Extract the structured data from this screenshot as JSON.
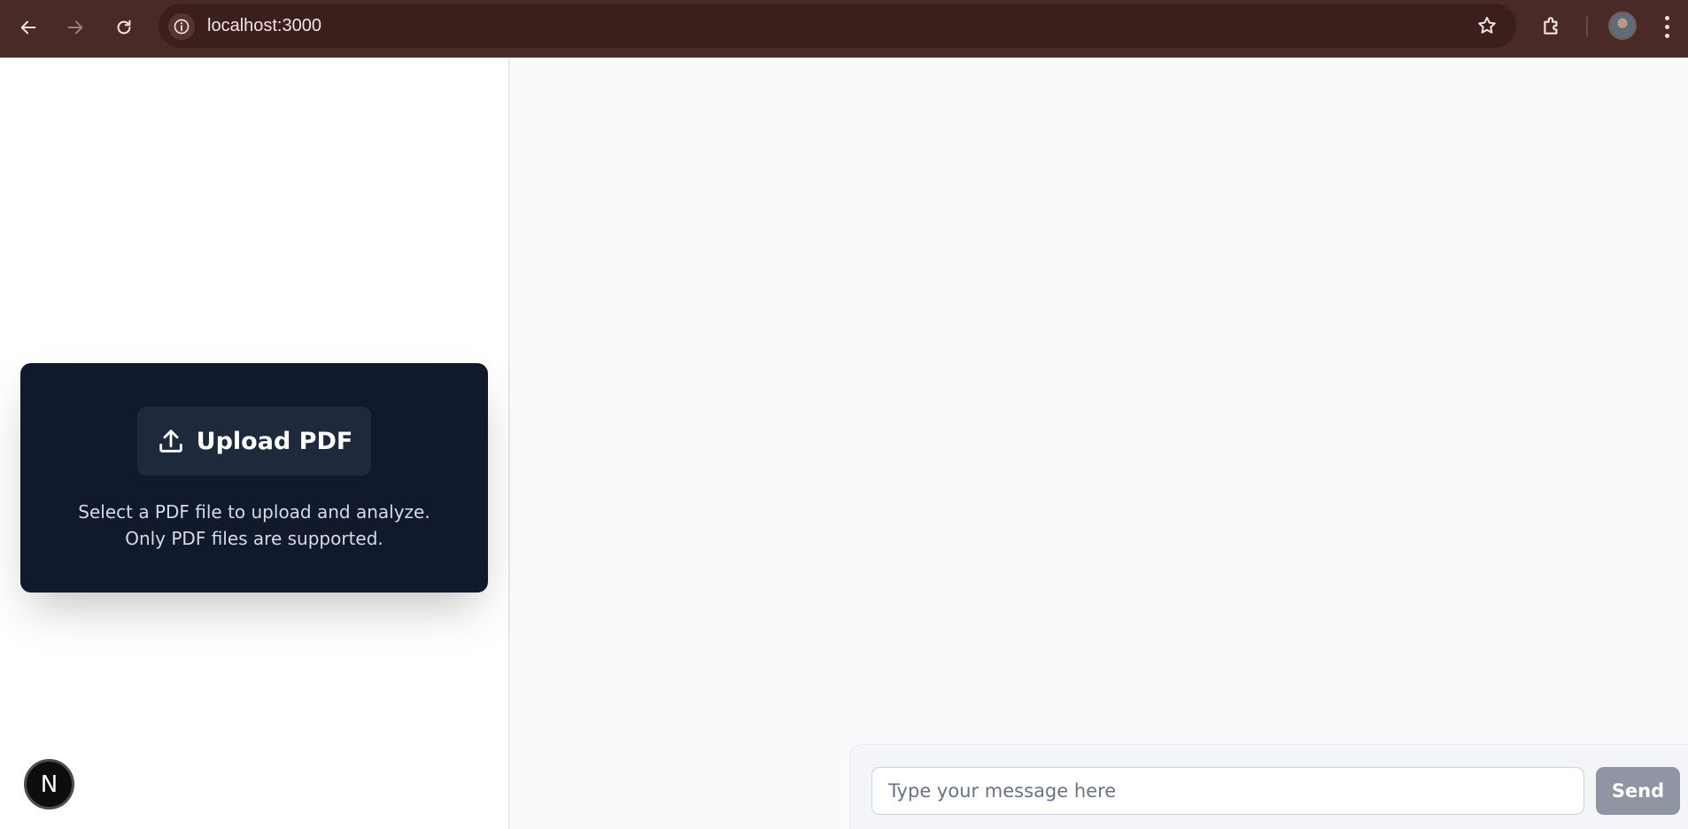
{
  "browser": {
    "url": "localhost:3000",
    "icons": {
      "back": "arrow-left-icon",
      "forward": "arrow-right-icon",
      "reload": "reload-icon",
      "site_info": "info-icon",
      "bookmark": "star-icon",
      "extensions": "puzzle-icon",
      "profile": "avatar",
      "menu": "kebab-menu-icon"
    },
    "colors": {
      "toolbar": "#4a2a27",
      "address_bar": "#3b1f1d"
    }
  },
  "upload_panel": {
    "button_label": "Upload PDF",
    "description": "Select a PDF file to upload and analyze. Only PDF files are supported.",
    "icon": "upload-icon",
    "colors": {
      "card": "#111a2d",
      "button": "#1e293b"
    }
  },
  "dev_badge": {
    "label": "N"
  },
  "chat": {
    "input_placeholder": "Type your message here",
    "input_value": "",
    "send_label": "Send",
    "colors": {
      "send_button": "#8e96a3",
      "background": "#f8fafc"
    }
  }
}
